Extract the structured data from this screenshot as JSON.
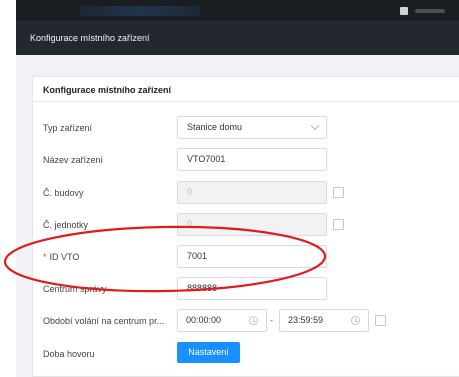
{
  "window": {
    "title": "Konfigurace místního zařízení"
  },
  "panel": {
    "title": "Konfigurace místního zařízení",
    "rows": [
      {
        "label": "Typ zařízení",
        "value": "Stanice domu"
      },
      {
        "label": "Název zařízení",
        "value": "VTO7001"
      },
      {
        "label": "Č. budovy",
        "value": "0"
      },
      {
        "label": "Č. jednotky",
        "value": "0"
      },
      {
        "required_mark": "*",
        "label": "ID VTO",
        "value": "7001"
      },
      {
        "label": "Centrum správy",
        "value": "888888"
      },
      {
        "label": "Období volání na centrum pr...",
        "start": "00:00:00",
        "separator": "-",
        "end": "23:59:59"
      },
      {
        "label": "Doba hovoru",
        "button": "Nastavení"
      }
    ]
  },
  "colors": {
    "accent": "#1890ff",
    "annotation": "#e01b1b",
    "titlebar": "#23282e"
  }
}
